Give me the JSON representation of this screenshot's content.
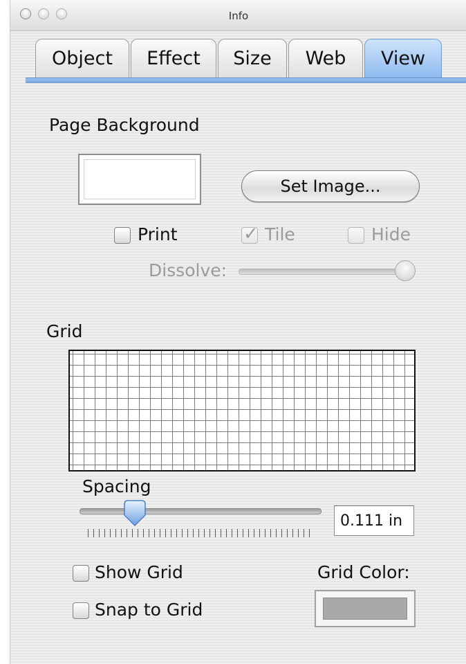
{
  "window": {
    "title": "Info"
  },
  "tabs": [
    {
      "label": "Object"
    },
    {
      "label": "Effect"
    },
    {
      "label": "Size"
    },
    {
      "label": "Web"
    },
    {
      "label": "View"
    }
  ],
  "page_background": {
    "heading": "Page Background",
    "set_image_label": "Set Image...",
    "print_label": "Print",
    "tile_label": "Tile",
    "hide_label": "Hide",
    "dissolve_label": "Dissolve:",
    "print_checked": false,
    "tile_checked": true,
    "hide_checked": false,
    "dissolve_value_fraction": 1.0
  },
  "grid": {
    "heading": "Grid",
    "spacing_label": "Spacing",
    "spacing_value": "0.111 in",
    "spacing_slider_fraction": 0.23,
    "show_grid_label": "Show Grid",
    "snap_label": "Snap to Grid",
    "show_grid_checked": false,
    "snap_checked": false,
    "color_label": "Grid Color:",
    "color": "#a9a9a9"
  },
  "colors": {
    "selected_tab": "#8ebaf0",
    "accent_blue": "#6e9fdc"
  }
}
